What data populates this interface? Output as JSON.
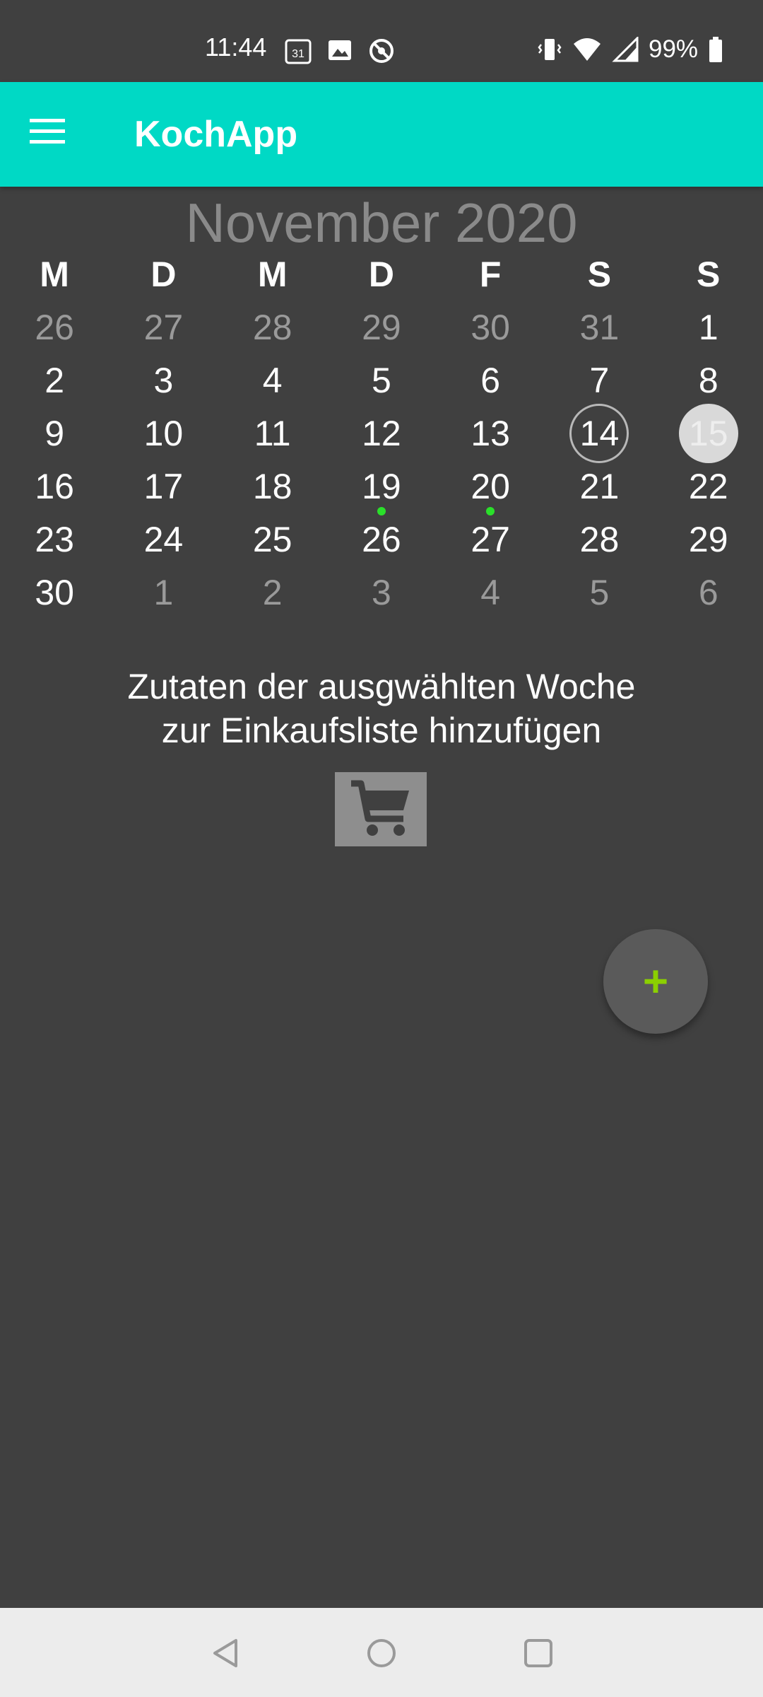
{
  "status_bar": {
    "time": "11:44",
    "calendar_icon_text": "31",
    "battery": "99%",
    "icons_left": [
      "calendar-icon",
      "image-icon",
      "sync-off-icon"
    ],
    "icons_right": [
      "vibrate-icon",
      "wifi-icon",
      "signal-icon",
      "battery-icon"
    ]
  },
  "app_bar": {
    "title": "KochApp",
    "menu_icon": "hamburger-menu-icon"
  },
  "calendar": {
    "month_title": "November 2020",
    "weekdays": [
      "M",
      "D",
      "M",
      "D",
      "F",
      "S",
      "S"
    ],
    "weeks": [
      [
        {
          "day": "26",
          "current_month": false
        },
        {
          "day": "27",
          "current_month": false
        },
        {
          "day": "28",
          "current_month": false
        },
        {
          "day": "29",
          "current_month": false
        },
        {
          "day": "30",
          "current_month": false
        },
        {
          "day": "31",
          "current_month": false
        },
        {
          "day": "1",
          "current_month": true
        }
      ],
      [
        {
          "day": "2",
          "current_month": true
        },
        {
          "day": "3",
          "current_month": true
        },
        {
          "day": "4",
          "current_month": true
        },
        {
          "day": "5",
          "current_month": true
        },
        {
          "day": "6",
          "current_month": true
        },
        {
          "day": "7",
          "current_month": true
        },
        {
          "day": "8",
          "current_month": true
        }
      ],
      [
        {
          "day": "9",
          "current_month": true
        },
        {
          "day": "10",
          "current_month": true
        },
        {
          "day": "11",
          "current_month": true
        },
        {
          "day": "12",
          "current_month": true
        },
        {
          "day": "13",
          "current_month": true
        },
        {
          "day": "14",
          "current_month": true,
          "today": true
        },
        {
          "day": "15",
          "current_month": true,
          "selected": true
        }
      ],
      [
        {
          "day": "16",
          "current_month": true
        },
        {
          "day": "17",
          "current_month": true
        },
        {
          "day": "18",
          "current_month": true
        },
        {
          "day": "19",
          "current_month": true,
          "event": true
        },
        {
          "day": "20",
          "current_month": true,
          "event": true
        },
        {
          "day": "21",
          "current_month": true
        },
        {
          "day": "22",
          "current_month": true
        }
      ],
      [
        {
          "day": "23",
          "current_month": true
        },
        {
          "day": "24",
          "current_month": true
        },
        {
          "day": "25",
          "current_month": true
        },
        {
          "day": "26",
          "current_month": true
        },
        {
          "day": "27",
          "current_month": true
        },
        {
          "day": "28",
          "current_month": true
        },
        {
          "day": "29",
          "current_month": true
        }
      ],
      [
        {
          "day": "30",
          "current_month": true
        },
        {
          "day": "1",
          "current_month": false
        },
        {
          "day": "2",
          "current_month": false
        },
        {
          "day": "3",
          "current_month": false
        },
        {
          "day": "4",
          "current_month": false
        },
        {
          "day": "5",
          "current_month": false
        },
        {
          "day": "6",
          "current_month": false
        }
      ]
    ]
  },
  "main": {
    "instruction_line1": "Zutaten der ausgwählten Woche",
    "instruction_line2": "zur Einkaufsliste hinzufügen",
    "cart_icon": "shopping-cart-icon",
    "fab_label": "+"
  },
  "nav_bar": {
    "buttons": [
      "back-icon",
      "home-icon",
      "recents-icon"
    ]
  },
  "colors": {
    "accent": "#00D9C5",
    "background": "#404040",
    "event_dot": "#2AE02A",
    "fab_plus": "#8BD000"
  }
}
